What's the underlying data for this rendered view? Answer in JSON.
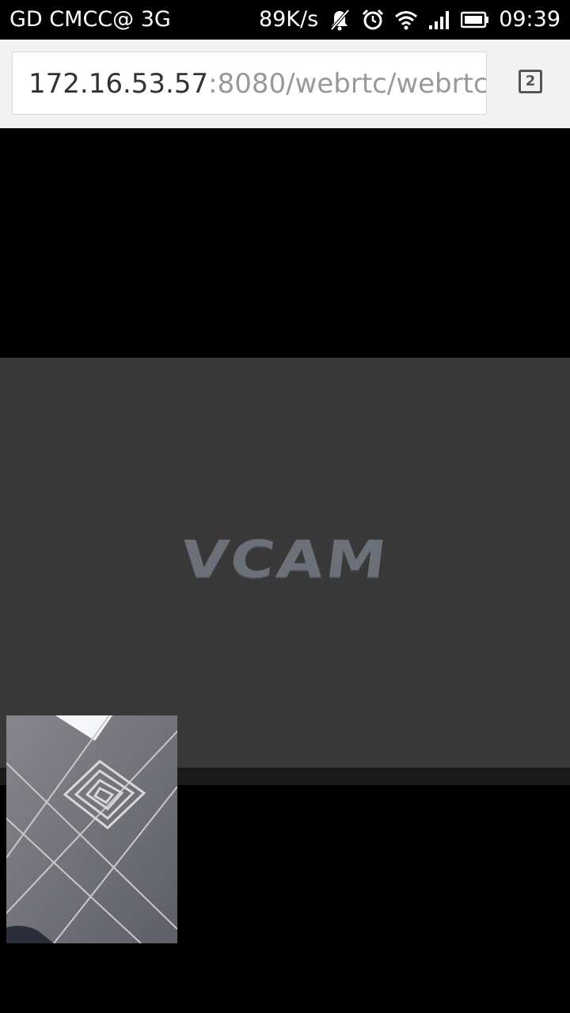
{
  "status_bar": {
    "carrier": "GD CMCC@ 3G",
    "net_speed": "89K/s",
    "time": "09:39",
    "icons": [
      "notifications-muted-icon",
      "alarm-icon",
      "wifi-icon",
      "signal-icon",
      "battery-icon"
    ]
  },
  "browser": {
    "url_host": "172.16.53.57",
    "url_path": ":8080/webrtc/webrtc",
    "tab_count": "2"
  },
  "video": {
    "remote_watermark": "VCAM"
  }
}
